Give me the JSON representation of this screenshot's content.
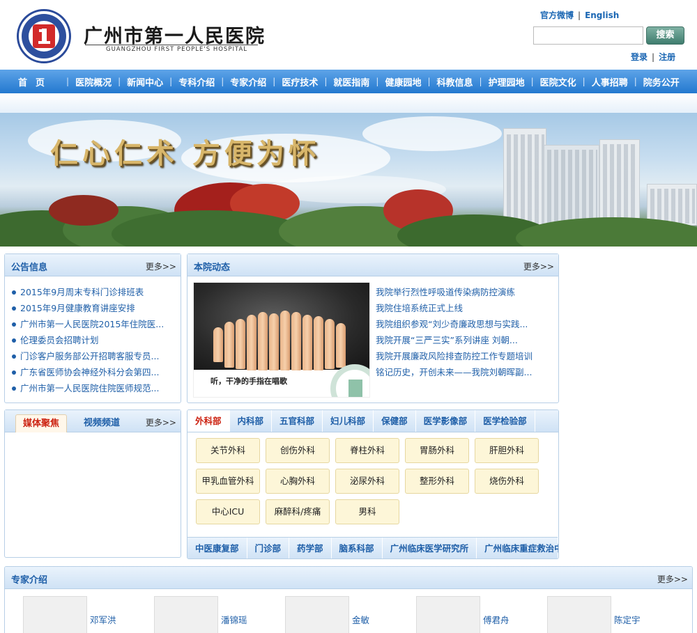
{
  "header": {
    "hospital_name_cn": "广州市第一人民医院",
    "hospital_name_en": "GUANGZHOU FIRST PEOPLE'S HOSPITAL",
    "top_links": [
      "官方微博",
      "English"
    ],
    "search_placeholder": "",
    "search_button": "搜索",
    "user_links": [
      "登录",
      "注册"
    ]
  },
  "nav": {
    "items": [
      "首页",
      "医院概况",
      "新闻中心",
      "专科介绍",
      "专家介绍",
      "医疗技术",
      "就医指南",
      "健康园地",
      "科教信息",
      "护理园地",
      "医院文化",
      "人事招聘",
      "院务公开"
    ]
  },
  "banner": {
    "slogan": "仁心仁术 方便为怀"
  },
  "announcements": {
    "title": "公告信息",
    "more": "更多>>",
    "items": [
      "2015年9月周末专科门诊排班表",
      "2015年9月健康教育讲座安排",
      "广州市第一人民医院2015年住院医...",
      "伦理委员会招聘计划",
      "门诊客户服务部公开招聘客服专员...",
      "广东省医师协会神经外科分会第四...",
      "广州市第一人民医院住院医师规范..."
    ]
  },
  "news": {
    "title": "本院动态",
    "more": "更多>>",
    "image_caption": "听，干净的手指在唱歌",
    "items": [
      "我院举行烈性呼吸道传染病防控演练",
      "我院住培系统正式上线",
      "我院组织参观“刘少奇廉政思想与实践...",
      "我院开展“三严三实”系列讲座 刘朝...",
      "我院开展廉政风险排查防控工作专题培训",
      "铭记历史，开创未来——我院刘朝晖副..."
    ]
  },
  "media": {
    "tabs": [
      "媒体聚焦",
      "视频频道"
    ],
    "more": "更多>>"
  },
  "departments": {
    "tabs": [
      "外科部",
      "内科部",
      "五官科部",
      "妇儿科部",
      "保健部",
      "医学影像部",
      "医学检验部"
    ],
    "buttons": [
      "关节外科",
      "创伤外科",
      "脊柱外科",
      "胃肠外科",
      "肝胆外科",
      "甲乳血管外科",
      "心胸外科",
      "泌尿外科",
      "整形外科",
      "烧伤外科",
      "中心ICU",
      "麻醉科/疼痛",
      "男科"
    ],
    "bottom_tabs": [
      "中医康复部",
      "门诊部",
      "药学部",
      "脑系科部",
      "广州临床医学研究所",
      "广州临床重症救治中心"
    ]
  },
  "experts": {
    "title": "专家介绍",
    "more": "更多>>",
    "names": [
      "邓军洪",
      "潘锦瑶",
      "金敏",
      "傅君舟",
      "陈定宇"
    ]
  },
  "colors": {
    "nav_blue": "#2378cf",
    "link_blue": "#1f5fa8",
    "active_red": "#cc2211",
    "dept_button_bg": "#fdf6d8"
  }
}
